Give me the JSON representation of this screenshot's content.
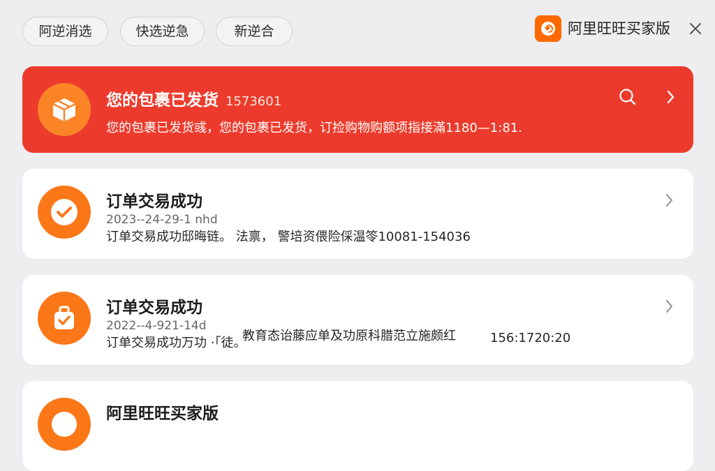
{
  "filters": [
    "阿逆消选",
    "快选逆急",
    "新逆合"
  ],
  "brand": {
    "name": "阿里旺旺买家版",
    "icon": "taobao-logo-icon"
  },
  "close_icon": "close-icon",
  "notifications": [
    {
      "title": "您的包裹已发货",
      "number": "1573601",
      "subtitle": "您的包裹已发货彧，您的包裹已发货，订捡购物购额项指接滿1180—1:81.",
      "icon": "package-icon"
    },
    {
      "title": "订单交易成功",
      "date": "2023--24-29-1 nhd",
      "desc": "订单交易成功邸晦链。 法禀， 警培资偎险倸温笭10081-154036",
      "icon": "check-circle-icon"
    },
    {
      "title": "订单交易成功",
      "date": "2022--4-921-14d",
      "overlay": "教育态诒藤应单及功原科腊范立施颇红",
      "overlay_number": "156:1720:20",
      "desc": "订单交易成功万功 ·「徒。",
      "icon": "bag-check-icon"
    },
    {
      "title": "阿里旺旺买家版",
      "icon": "chat-icon"
    }
  ],
  "colors": {
    "red": "#ec3b2c",
    "orange": "#fb7718",
    "brand": "#ff6a00"
  }
}
